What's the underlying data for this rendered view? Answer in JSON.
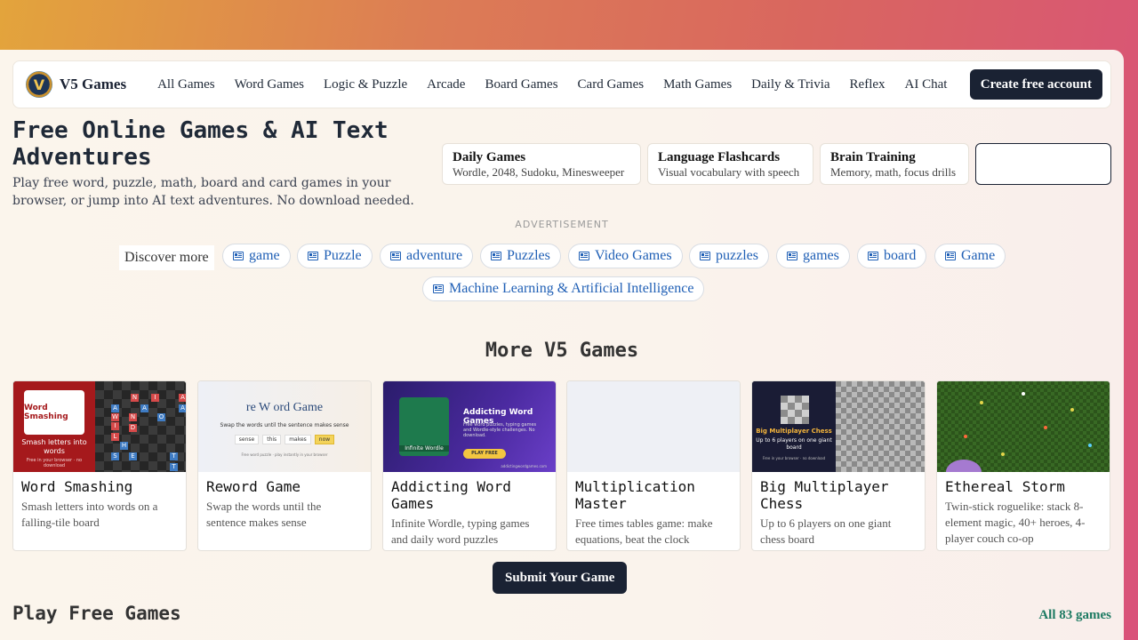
{
  "brand": {
    "name": "V5 Games",
    "logo_letter": "V"
  },
  "nav": {
    "links": [
      "All Games",
      "Word Games",
      "Logic & Puzzle",
      "Arcade",
      "Board Games",
      "Card Games",
      "Math Games",
      "Daily & Trivia",
      "Reflex",
      "AI Chat"
    ],
    "cta": "Create free account"
  },
  "hero": {
    "title": "Free Online Games & AI Text Adventures",
    "subtitle": "Play free word, puzzle, math, board and card games in your browser, or jump into AI text adventures. No download needed."
  },
  "quick_links": [
    {
      "title": "Daily Games",
      "desc": "Wordle, 2048, Sudoku, Minesweeper"
    },
    {
      "title": "Language Flashcards",
      "desc": "Visual vocabulary with speech"
    },
    {
      "title": "Brain Training",
      "desc": "Memory, math, focus drills"
    }
  ],
  "ad": {
    "label": "ADVERTISEMENT",
    "discover": "Discover more"
  },
  "chips": [
    "game",
    "Puzzle",
    "adventure",
    "Puzzles",
    "Video Games",
    "puzzles",
    "games",
    "board",
    "Game",
    "Machine Learning & Artificial Intelligence"
  ],
  "more_section": {
    "title": "More V5 Games"
  },
  "cards": [
    {
      "title": "Word Smashing",
      "desc": "Smash letters into words on a falling-tile board",
      "thumb": {
        "logo": "Word Smashing",
        "tagline": "Smash letters into words",
        "footer": "Free in your browser · no download"
      }
    },
    {
      "title": "Reword Game",
      "desc": "Swap the words until the sentence makes sense",
      "thumb": {
        "logo": "re W ord Game",
        "tagline": "Swap the words until the sentence makes sense",
        "words": [
          "sense",
          "this",
          "makes",
          "now"
        ],
        "footer": "Free word puzzle · play instantly in your browser"
      }
    },
    {
      "title": "Addicting Word Games",
      "desc": "Infinite Wordle, typing games and daily word puzzles",
      "thumb": {
        "heading": "Addicting Word Games",
        "text": "Free word puzzles, typing games and Wordle-style challenges. No download.",
        "button": "PLAY FREE",
        "caption": "Infinite Wordle",
        "url": "addictingwordgames.com"
      }
    },
    {
      "title": "Multiplication Master",
      "desc": "Free times tables game: make equations, beat the clock",
      "thumb": {}
    },
    {
      "title": "Big Multiplayer Chess",
      "desc": "Up to 6 players on one giant chess board",
      "thumb": {
        "heading": "Big Multiplayer Chess",
        "tagline": "Up to 6 players on one giant board",
        "footer": "Free in your browser · no download"
      }
    },
    {
      "title": "Ethereal Storm",
      "desc": "Twin-stick roguelike: stack 8-element magic, 40+ heroes, 4-player couch co-op",
      "thumb": {}
    }
  ],
  "submit_button": "Submit Your Game",
  "play_section": {
    "title": "Play Free Games",
    "all_link": "All 83 games"
  },
  "colors": {
    "dark": "#1a2233",
    "link_blue": "#1f5fb5",
    "accent_green": "#1d7a62"
  }
}
